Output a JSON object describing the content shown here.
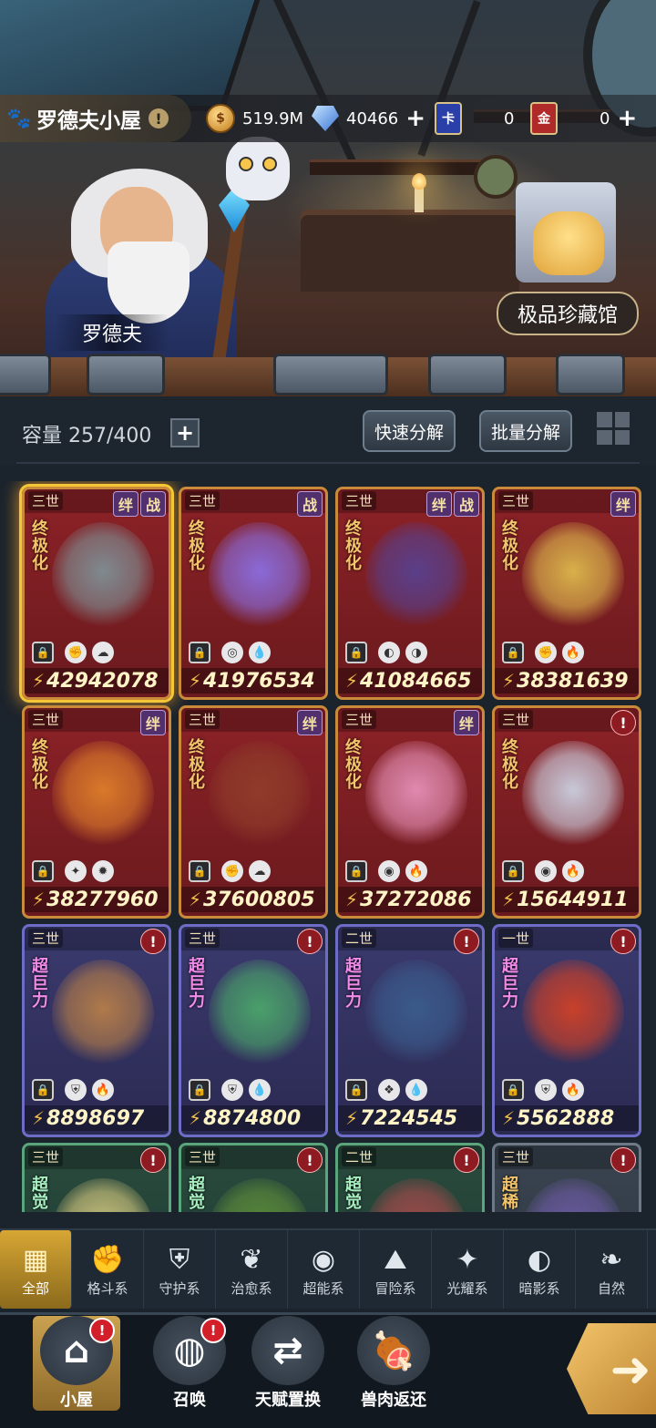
{
  "header": {
    "house_name": "罗德夫小屋",
    "npc_name": "罗德夫",
    "museum_button": "极品珍藏馆"
  },
  "resources": {
    "gold": "519.9M",
    "crystal": "40466",
    "card1_label": "卡",
    "card1_count": "0",
    "card2_label": "金",
    "card2_count": "0"
  },
  "toolbar": {
    "capacity_label": "容量 257/400",
    "quick_decompose": "快速分解",
    "batch_decompose": "批量分解"
  },
  "cards": [
    {
      "gen": "三世",
      "badges": [
        "绊",
        "战"
      ],
      "tag": "终极化",
      "power": "42942078",
      "theme": "red",
      "art": "#7f8a8f",
      "elems": [
        "✊",
        "☁"
      ],
      "selected": true
    },
    {
      "gen": "三世",
      "badges": [
        "战"
      ],
      "tag": "终极化",
      "power": "41976534",
      "theme": "red",
      "art": "#8a6ad8",
      "elems": [
        "◎",
        "💧"
      ]
    },
    {
      "gen": "三世",
      "badges": [
        "绊",
        "战"
      ],
      "tag": "终极化",
      "power": "41084665",
      "theme": "red",
      "art": "#5a3f8a",
      "elems": [
        "◐",
        "◑"
      ]
    },
    {
      "gen": "三世",
      "badges": [
        "绊"
      ],
      "tag": "终极化",
      "power": "38381639",
      "theme": "red",
      "art": "#d8b04a",
      "elems": [
        "✊",
        "🔥"
      ]
    },
    {
      "gen": "三世",
      "badges": [
        "绊"
      ],
      "tag": "终极化",
      "power": "38277960",
      "theme": "red",
      "art": "#d9792a",
      "elems": [
        "✦",
        "✹"
      ]
    },
    {
      "gen": "三世",
      "badges": [
        "绊"
      ],
      "tag": "终极化",
      "power": "37600805",
      "theme": "red",
      "art": "#8f3b2a",
      "elems": [
        "✊",
        "☁"
      ]
    },
    {
      "gen": "三世",
      "badges": [
        "绊"
      ],
      "tag": "终极化",
      "power": "37272086",
      "theme": "red",
      "art": "#e08ab0",
      "elems": [
        "◉",
        "🔥"
      ]
    },
    {
      "gen": "三世",
      "badges": [
        "!"
      ],
      "tag": "终极化",
      "power": "15644911",
      "theme": "red",
      "art": "#c8c8d8",
      "elems": [
        "◉",
        "🔥"
      ]
    },
    {
      "gen": "三世",
      "badges": [
        "!"
      ],
      "tag": "超巨力",
      "power": "8898697",
      "theme": "purple",
      "art": "#b07a4a",
      "elems": [
        "⛨",
        "🔥"
      ]
    },
    {
      "gen": "三世",
      "badges": [
        "!"
      ],
      "tag": "超巨力",
      "power": "8874800",
      "theme": "purple",
      "art": "#4aa06a",
      "elems": [
        "⛨",
        "💧"
      ]
    },
    {
      "gen": "二世",
      "badges": [
        "!"
      ],
      "tag": "超巨力",
      "power": "7224545",
      "theme": "purple",
      "art": "#3a5a8a",
      "elems": [
        "❖",
        "💧"
      ]
    },
    {
      "gen": "一世",
      "badges": [
        "!"
      ],
      "tag": "超巨力",
      "power": "5562888",
      "theme": "purple",
      "art": "#c8402a",
      "elems": [
        "⛨",
        "🔥"
      ]
    },
    {
      "gen": "三世",
      "badges": [
        "!"
      ],
      "tag": "超觉",
      "power": "",
      "theme": "green",
      "art": "#c9c07a",
      "elems": []
    },
    {
      "gen": "三世",
      "badges": [
        "!"
      ],
      "tag": "超觉",
      "power": "",
      "theme": "green",
      "art": "#5a8a3a",
      "elems": []
    },
    {
      "gen": "二世",
      "badges": [
        "!"
      ],
      "tag": "超觉",
      "power": "",
      "theme": "green",
      "art": "#a04a4a",
      "elems": []
    },
    {
      "gen": "三世",
      "badges": [
        "!"
      ],
      "tag": "超稀",
      "power": "",
      "theme": "grey",
      "art": "#6a5aa0",
      "elems": []
    }
  ],
  "categories": [
    {
      "label": "全部",
      "icon": "▦"
    },
    {
      "label": "格斗系",
      "icon": "✊"
    },
    {
      "label": "守护系",
      "icon": "⛨"
    },
    {
      "label": "治愈系",
      "icon": "❦"
    },
    {
      "label": "超能系",
      "icon": "◉"
    },
    {
      "label": "冒险系",
      "icon": "⛰"
    },
    {
      "label": "光耀系",
      "icon": "✦"
    },
    {
      "label": "暗影系",
      "icon": "◐"
    },
    {
      "label": "自然",
      "icon": "❧"
    }
  ],
  "bottom_nav": [
    {
      "label": "小屋",
      "icon": "⌂"
    },
    {
      "label": "召唤",
      "icon": "◍"
    },
    {
      "label": "天赋置换",
      "icon": "⇄"
    },
    {
      "label": "兽肉返还",
      "icon": "🍖"
    }
  ],
  "colors": {
    "accent": "#d7a634",
    "card_red": "#8c2227",
    "card_purple": "#3b3a6e",
    "alert": "#d21f2a"
  }
}
